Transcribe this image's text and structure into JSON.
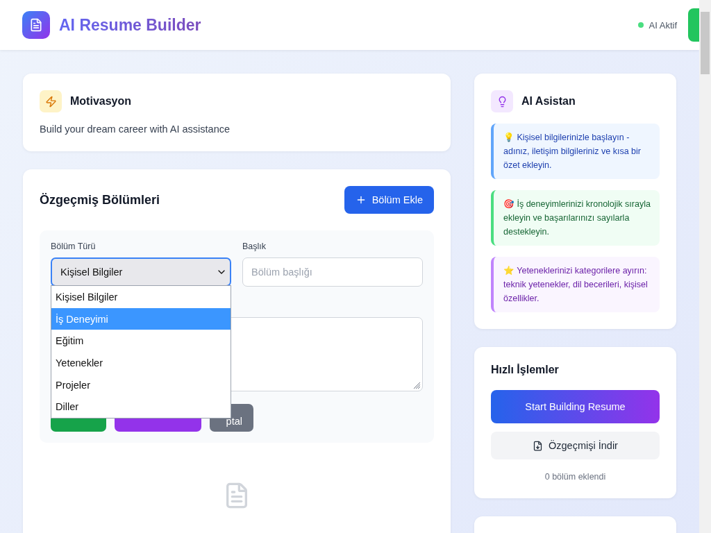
{
  "header": {
    "title": "AI Resume Builder",
    "status": {
      "label": "AI Aktif",
      "on": true
    }
  },
  "motivation": {
    "title": "Motivasyon",
    "text": "Build your dream career with AI assistance"
  },
  "sections": {
    "title": "Özgeçmiş Bölümleri",
    "add_button": "Bölüm Ekle",
    "form": {
      "type_label": "Bölüm Türü",
      "type_value": "Kişisel Bilgiler",
      "title_label": "Başlık",
      "title_placeholder": "Bölüm başlığı",
      "options": [
        {
          "label": "Kişisel Bilgiler",
          "selected": false
        },
        {
          "label": "İş Deneyimi",
          "selected": true
        },
        {
          "label": "Eğitim",
          "selected": false
        },
        {
          "label": "Yetenekler",
          "selected": false
        },
        {
          "label": "Projeler",
          "selected": false
        },
        {
          "label": "Diller",
          "selected": false
        }
      ],
      "buttons": [
        {
          "kind": "save"
        },
        {
          "kind": "ai"
        },
        {
          "kind": "cancel",
          "label": "ptal"
        }
      ]
    }
  },
  "assistant": {
    "title": "AI Asistan",
    "tips": [
      {
        "kind": "idea",
        "color": "#60a5fa",
        "text": "💡 Kişisel bilgilerinizle başlayın - adınız, iletişim bilgileriniz ve kısa bir özet ekleyin."
      },
      {
        "kind": "target",
        "color": "#4ade80",
        "text": "🎯 İş deneyimlerinizi kronolojik sırayla ekleyin ve başarılarınızı sayılarla destekleyin."
      },
      {
        "kind": "star",
        "color": "#c084fc",
        "text": "⭐ Yeteneklerinizi kategorilere ayırın: teknik yetenekler, dil becerileri, kişisel özellikler."
      }
    ]
  },
  "quick_actions": {
    "title": "Hızlı İşlemler",
    "primary": "Start Building Resume",
    "download": "Özgeçmişi İndir",
    "count": "0 bölüm eklendi"
  }
}
